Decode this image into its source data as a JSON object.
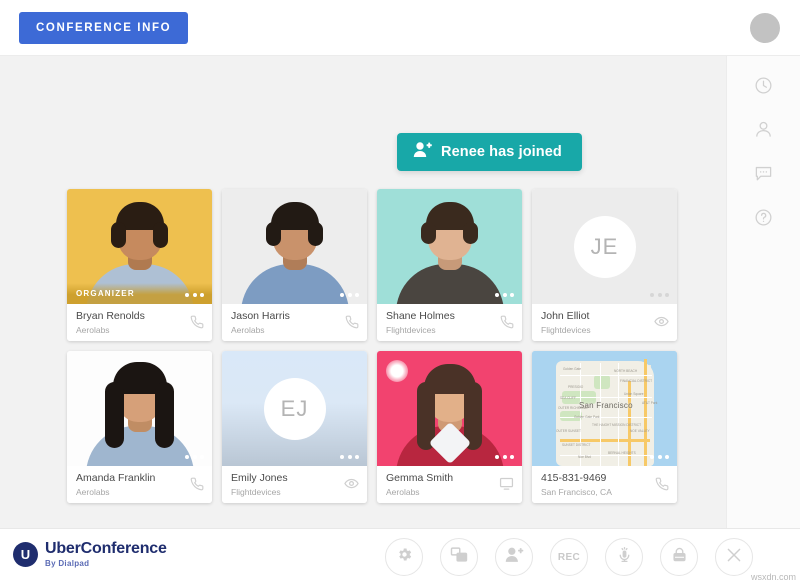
{
  "header": {
    "conference_info_label": "CONFERENCE INFO",
    "avatar_icon": "user-avatar-circle"
  },
  "toast": {
    "message": "Renee has joined",
    "icon": "person-add-icon",
    "color": "#18a8a8"
  },
  "rail": {
    "items": [
      {
        "name": "history",
        "icon": "clock-icon"
      },
      {
        "name": "participants",
        "icon": "person-icon"
      },
      {
        "name": "chat",
        "icon": "chat-bubble-icon"
      },
      {
        "name": "help",
        "icon": "question-circle-icon"
      }
    ]
  },
  "participants": [
    {
      "name": "Bryan Renolds",
      "company": "Aerolabs",
      "badge": "ORGANIZER",
      "action_icon": "phone-icon",
      "dots_icon": "more-dots-icon",
      "bg": "#eec04f",
      "hair": "#2a1d13",
      "skin": "#c68a5e",
      "shirt": "#b8c7d8",
      "type": "photo",
      "speaking": false
    },
    {
      "name": "Jason Harris",
      "company": "Aerolabs",
      "badge": "",
      "action_icon": "phone-icon",
      "dots_icon": "more-dots-icon",
      "bg": "#ececec",
      "hair": "#221a14",
      "skin": "#c9926b",
      "shirt": "#7d9cc2",
      "type": "photo",
      "speaking": false
    },
    {
      "name": "Shane Holmes",
      "company": "Flightdevices",
      "badge": "",
      "action_icon": "phone-icon",
      "dots_icon": "more-dots-icon",
      "bg": "#9fdfd8",
      "hair": "#3a2a1e",
      "skin": "#e0b392",
      "shirt": "#4a4540",
      "type": "photo",
      "speaking": false
    },
    {
      "name": "John Elliot",
      "company": "Flightdevices",
      "badge": "",
      "action_icon": "eye-icon",
      "dots_icon": "more-dots-icon",
      "bg": "#ececec",
      "initials": "JE",
      "type": "initials",
      "speaking": false
    },
    {
      "name": "Amanda Franklin",
      "company": "Aerolabs",
      "badge": "",
      "action_icon": "phone-icon",
      "dots_icon": "more-dots-icon",
      "bg": "#ffffff",
      "hair": "#1b1512",
      "skin": "#d6a079",
      "shirt": "#9fb6cf",
      "type": "photo",
      "speaking": false
    },
    {
      "name": "Emily Jones",
      "company": "Flightdevices",
      "badge": "",
      "action_icon": "eye-icon",
      "dots_icon": "more-dots-icon",
      "bg": "#d8e6f5",
      "initials": "EJ",
      "type": "initials",
      "speaking": false
    },
    {
      "name": "Gemma Smith",
      "company": "Aerolabs",
      "badge": "",
      "action_icon": "screen-icon",
      "dots_icon": "more-dots-icon",
      "bg": "#f2436f",
      "hair": "#4a3227",
      "skin": "#e2b089",
      "shirt": "#b8263f",
      "type": "photo",
      "speaking": true
    },
    {
      "name": "415-831-9469",
      "company": "San Francisco, CA",
      "badge": "",
      "action_icon": "phone-icon",
      "dots_icon": "more-dots-icon",
      "type": "map",
      "map_label": "San Francisco",
      "map_minor_labels": [
        "Golden Gate",
        "PRESIDIO",
        "NORTH BEACH",
        "FINANCIAL DISTRICT",
        "Union Square",
        "AT&T Park",
        "SEA CLIFF",
        "OUTER RICHMOND",
        "Golden Gate Park",
        "THE HAIGHT",
        "MISSION DISTRICT",
        "NOE VALLEY",
        "OUTER SUNSET",
        "SUNSET DISTRICT",
        "Noe Blvd",
        "BERNAL HEIGHTS"
      ],
      "speaking": false
    }
  ],
  "footer": {
    "logo_mark": "U",
    "logo_title": "UberConference",
    "logo_subtitle": "By Dialpad",
    "tools": [
      {
        "name": "settings",
        "icon": "gear-icon",
        "label": ""
      },
      {
        "name": "share-screen",
        "icon": "screens-icon",
        "label": ""
      },
      {
        "name": "add-participant",
        "icon": "person-add-icon",
        "label": ""
      },
      {
        "name": "record",
        "icon": "rec-text-icon",
        "label": "REC"
      },
      {
        "name": "mute",
        "icon": "microphone-icon",
        "label": ""
      },
      {
        "name": "lock",
        "icon": "lock-icon",
        "label": ""
      },
      {
        "name": "end-call",
        "icon": "close-x-icon",
        "label": ""
      }
    ],
    "watermark": "wsxdn.com"
  }
}
